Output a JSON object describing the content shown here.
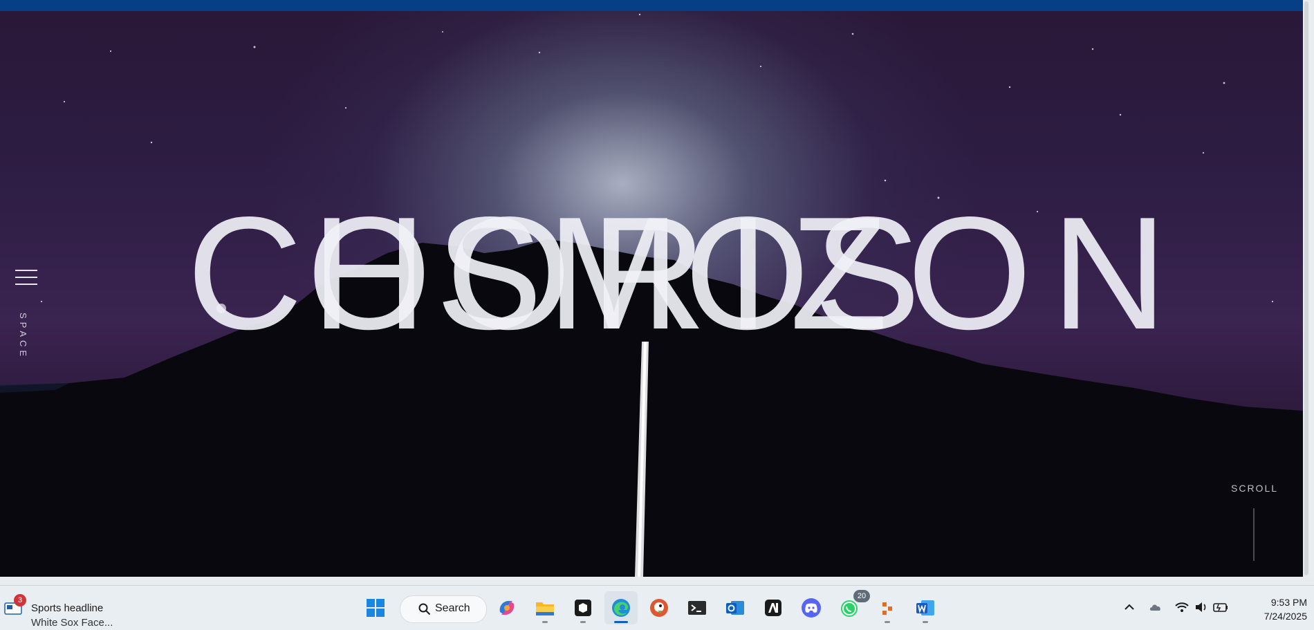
{
  "page": {
    "hero_title_a": "COSMOS",
    "hero_title_b": "HORIZON",
    "side_label": "SPACE",
    "scroll_label": "SCROLL"
  },
  "taskbar": {
    "news": {
      "badge": "3",
      "title": "Sports headline",
      "subtitle": "White Sox Face..."
    },
    "search_label": "Search",
    "apps": [
      {
        "name": "windows-start"
      },
      {
        "name": "copilot"
      },
      {
        "name": "file-explorer"
      },
      {
        "name": "terminal-box"
      },
      {
        "name": "edge"
      },
      {
        "name": "duckduckgo"
      },
      {
        "name": "terminal"
      },
      {
        "name": "outlook"
      },
      {
        "name": "ai-app"
      },
      {
        "name": "discord"
      },
      {
        "name": "whatsapp",
        "badge": "20"
      },
      {
        "name": "app-blocks"
      },
      {
        "name": "word"
      }
    ],
    "time": "9:53 PM",
    "date": "7/24/2025"
  },
  "colors": {
    "topbar": "#063f86",
    "sky_dark": "#2a1838",
    "title_color": "#f0f0f6",
    "accent": "#0a5fbf"
  }
}
